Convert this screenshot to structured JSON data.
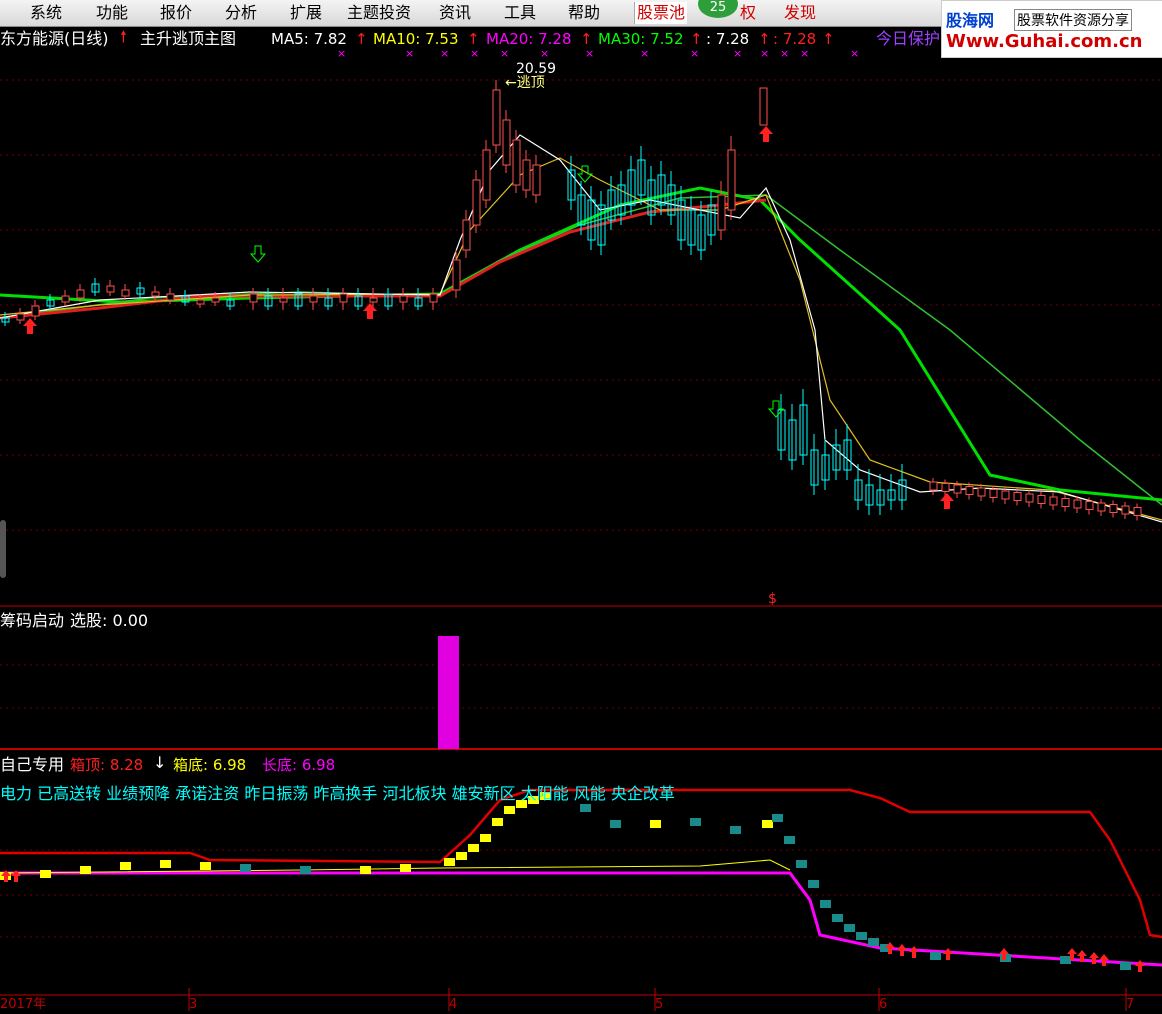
{
  "menu": {
    "items": [
      "系统",
      "功能",
      "报价",
      "分析",
      "扩展",
      "主题投资",
      "资讯",
      "工具",
      "帮助"
    ],
    "stock_pool": "股票池",
    "badge_count": "25",
    "partial_item": "权",
    "discover": "发现"
  },
  "brand": {
    "name": "股海网",
    "slogan": "股票软件资源分享",
    "url": "Www.Guhai.com.cn"
  },
  "main_chart": {
    "title": "东方能源(日线)",
    "formula": "主升逃顶主图",
    "ma5": "MA5: 7.82",
    "ma10": "MA10: 7.53",
    "ma20": "MA20: 7.28",
    "ma30": "MA30: 7.52",
    "extra1": ": 7.28",
    "extra2": ": 7.28",
    "today_label": "今日保护",
    "peak_value": "20.59",
    "escape_label": "←逃顶",
    "dollar_marker": "$"
  },
  "indicator1": {
    "title": "筹码启动",
    "select_label": "选股: 0.00"
  },
  "indicator2": {
    "title": "自己专用",
    "box_top": "箱顶: 8.28",
    "box_bottom": "箱底: 6.98",
    "long_bottom": "长底: 6.98",
    "concepts": "电力 已高送转 业绩预降 承诺注资 昨日振荡 昨高换手 河北板块 雄安新区 太阳能 风能 央企改革"
  },
  "x_axis": [
    "2017年",
    "3",
    "4",
    "5",
    "6",
    "7"
  ],
  "colors": {
    "up": "#ff5050",
    "down": "#00ffff",
    "ma5": "#ffffff",
    "ma10": "#ffff00",
    "ma20": "#ff00ff",
    "ma30": "#00ff00",
    "panel_border": "#c00000",
    "magenta_bar": "#e000e0"
  }
}
